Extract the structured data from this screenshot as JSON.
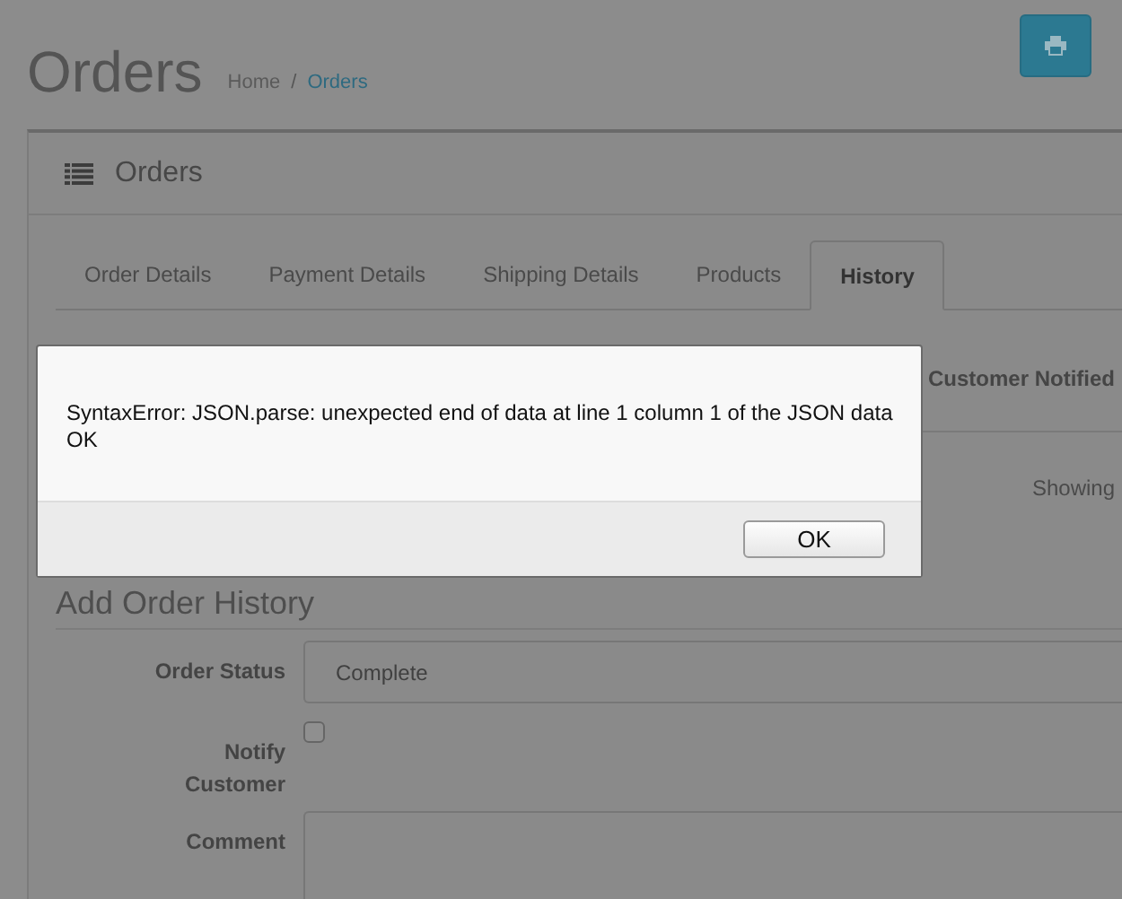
{
  "page": {
    "title": "Orders",
    "separator": "/",
    "breadcrumb": [
      {
        "label": "Home",
        "selected": false
      },
      {
        "label": "Orders",
        "selected": true
      }
    ]
  },
  "panel": {
    "title": "Orders"
  },
  "tabs": [
    {
      "label": "Order Details",
      "selected": false
    },
    {
      "label": "Payment Details",
      "selected": false
    },
    {
      "label": "Shipping Details",
      "selected": false
    },
    {
      "label": "Products",
      "selected": false
    },
    {
      "label": "History",
      "selected": true
    }
  ],
  "table": {
    "columns": [
      "Customer Notified"
    ]
  },
  "pagination": {
    "text": "Showing"
  },
  "form": {
    "heading": "Add Order History",
    "fields": [
      {
        "kind": "select",
        "label": "Order Status",
        "value": "Complete"
      },
      {
        "kind": "checkbox",
        "label": "Notify Customer",
        "checked": false
      },
      {
        "kind": "textarea",
        "label": "Comment"
      }
    ]
  },
  "dialog": {
    "lines": [
      "SyntaxError: JSON.parse: unexpected end of data at line 1 column 1 of the JSON data",
      "OK"
    ],
    "button": "OK"
  }
}
